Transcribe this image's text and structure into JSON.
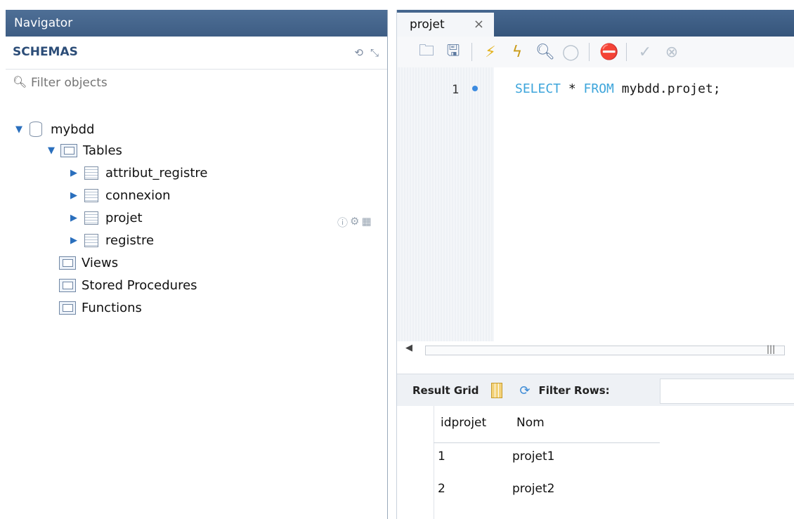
{
  "navigator": {
    "title": "Navigator",
    "schemas_label": "SCHEMAS",
    "filter_placeholder": "Filter objects",
    "schema": {
      "name": "mybdd",
      "tables_label": "Tables",
      "tables": [
        "attribut_registre",
        "connexion",
        "projet",
        "registre"
      ],
      "views_label": "Views",
      "procedures_label": "Stored Procedures",
      "functions_label": "Functions"
    }
  },
  "editor": {
    "tab_label": "projet",
    "line_number": "1",
    "sql": {
      "kw1": "SELECT",
      "star": " * ",
      "kw2": "FROM",
      "rest": " mybdd.projet;"
    }
  },
  "results": {
    "result_grid_label": "Result Grid",
    "filter_rows_label": "Filter Rows:",
    "columns": [
      "idprojet",
      "Nom"
    ],
    "rows": [
      [
        "1",
        "projet1"
      ],
      [
        "2",
        "projet2"
      ]
    ]
  }
}
